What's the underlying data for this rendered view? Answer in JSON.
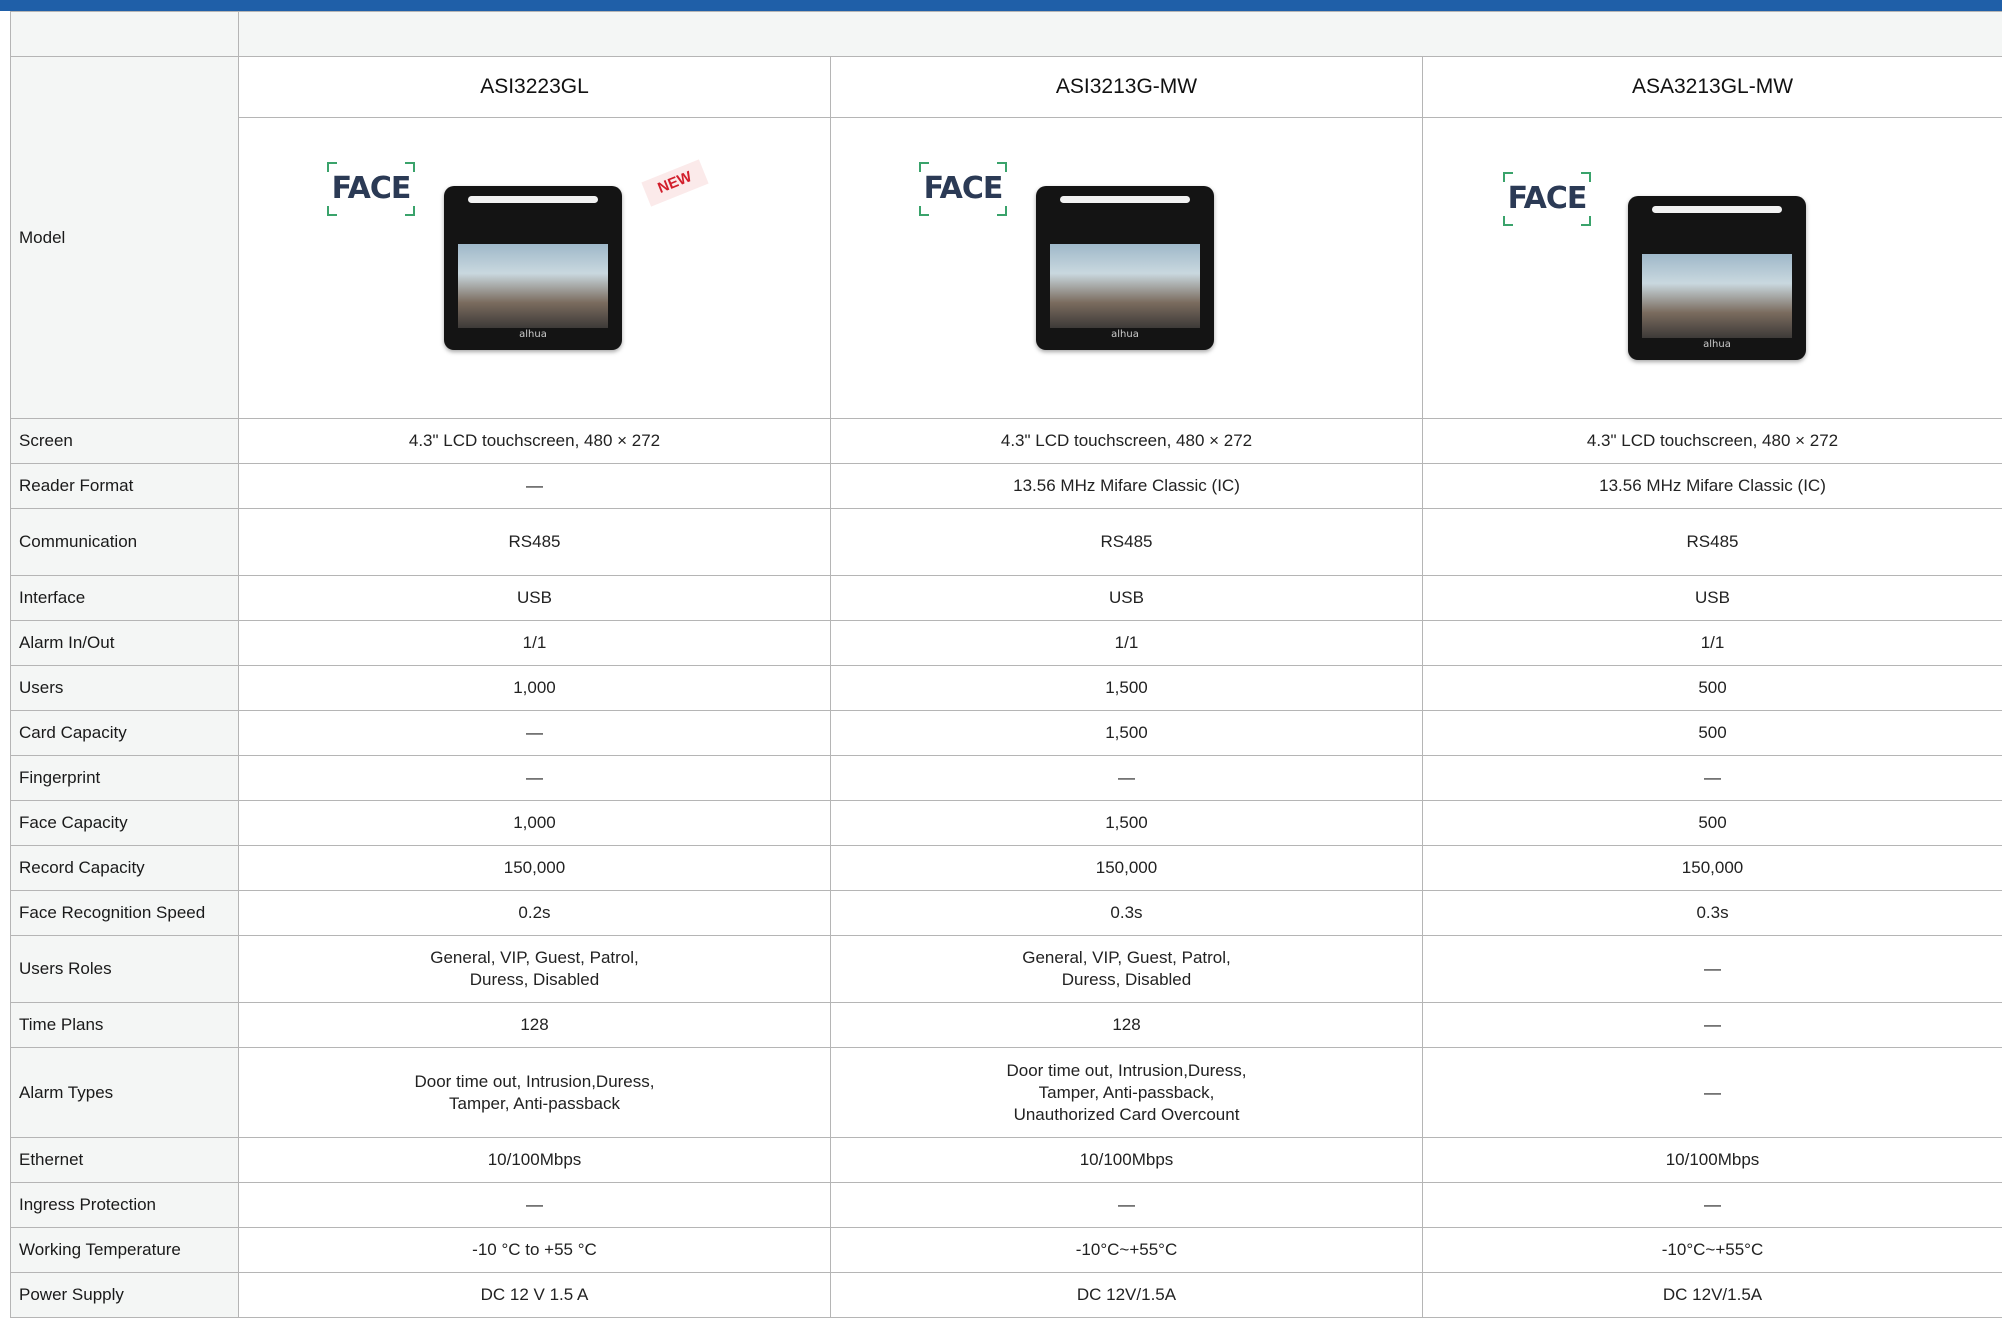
{
  "colors": {
    "top_bar": "#1f5fa8",
    "label_bg": "#f4f6f5",
    "border": "#b5b5b5",
    "facet_green": "#2e9e5b",
    "new_badge": "#d21e2b"
  },
  "images": {
    "logo_text": "FACE",
    "new_badge": "NEW",
    "device_brand": "alhua"
  },
  "table": {
    "model_label": "Model",
    "products": [
      "ASI3223GL",
      "ASI3213G-MW",
      "ASA3213GL-MW"
    ],
    "rows": [
      {
        "label": "Screen",
        "values": [
          "4.3\" LCD touchscreen, 480 × 272",
          "4.3\" LCD touchscreen, 480 × 272",
          "4.3\" LCD touchscreen, 480 × 272"
        ]
      },
      {
        "label": "Reader Format",
        "values": [
          "—",
          "13.56 MHz Mifare Classic (IC)",
          "13.56 MHz Mifare Classic (IC)"
        ]
      },
      {
        "label": "Communication",
        "values": [
          "RS485",
          "RS485",
          "RS485"
        ]
      },
      {
        "label": "Interface",
        "values": [
          "USB",
          "USB",
          "USB"
        ]
      },
      {
        "label": "Alarm In/Out",
        "values": [
          "1/1",
          "1/1",
          "1/1"
        ]
      },
      {
        "label": "Users",
        "values": [
          "1,000",
          "1,500",
          "500"
        ]
      },
      {
        "label": "Card Capacity",
        "values": [
          "—",
          "1,500",
          "500"
        ]
      },
      {
        "label": "Fingerprint",
        "values": [
          "—",
          "—",
          "—"
        ]
      },
      {
        "label": "Face Capacity",
        "values": [
          "1,000",
          "1,500",
          "500"
        ]
      },
      {
        "label": "Record Capacity",
        "values": [
          "150,000",
          "150,000",
          "150,000"
        ]
      },
      {
        "label": "Face Recognition Speed",
        "values": [
          "0.2s",
          "0.3s",
          "0.3s"
        ]
      },
      {
        "label": "Users Roles",
        "values": [
          [
            "General, VIP, Guest, Patrol,",
            "Duress, Disabled"
          ],
          [
            "General, VIP, Guest, Patrol,",
            "Duress, Disabled"
          ],
          [
            "—"
          ]
        ]
      },
      {
        "label": "Time Plans",
        "values": [
          "128",
          "128",
          "—"
        ]
      },
      {
        "label": "Alarm Types",
        "values": [
          [
            "Door time out, Intrusion,Duress,",
            "Tamper, Anti-passback"
          ],
          [
            "Door time out, Intrusion,Duress,",
            "Tamper, Anti-passback,",
            "Unauthorized Card Overcount"
          ],
          [
            "—"
          ]
        ]
      },
      {
        "label": "Ethernet",
        "values": [
          "10/100Mbps",
          "10/100Mbps",
          "10/100Mbps"
        ]
      },
      {
        "label": "Ingress Protection",
        "values": [
          "—",
          "—",
          "—"
        ]
      },
      {
        "label": "Working Temperature",
        "values": [
          "-10 °C to +55 °C",
          "-10°C~+55°C",
          "-10°C~+55°C"
        ]
      },
      {
        "label": "Power Supply",
        "values": [
          "DC 12 V 1.5 A",
          "DC 12V/1.5A",
          "DC 12V/1.5A"
        ]
      }
    ]
  }
}
